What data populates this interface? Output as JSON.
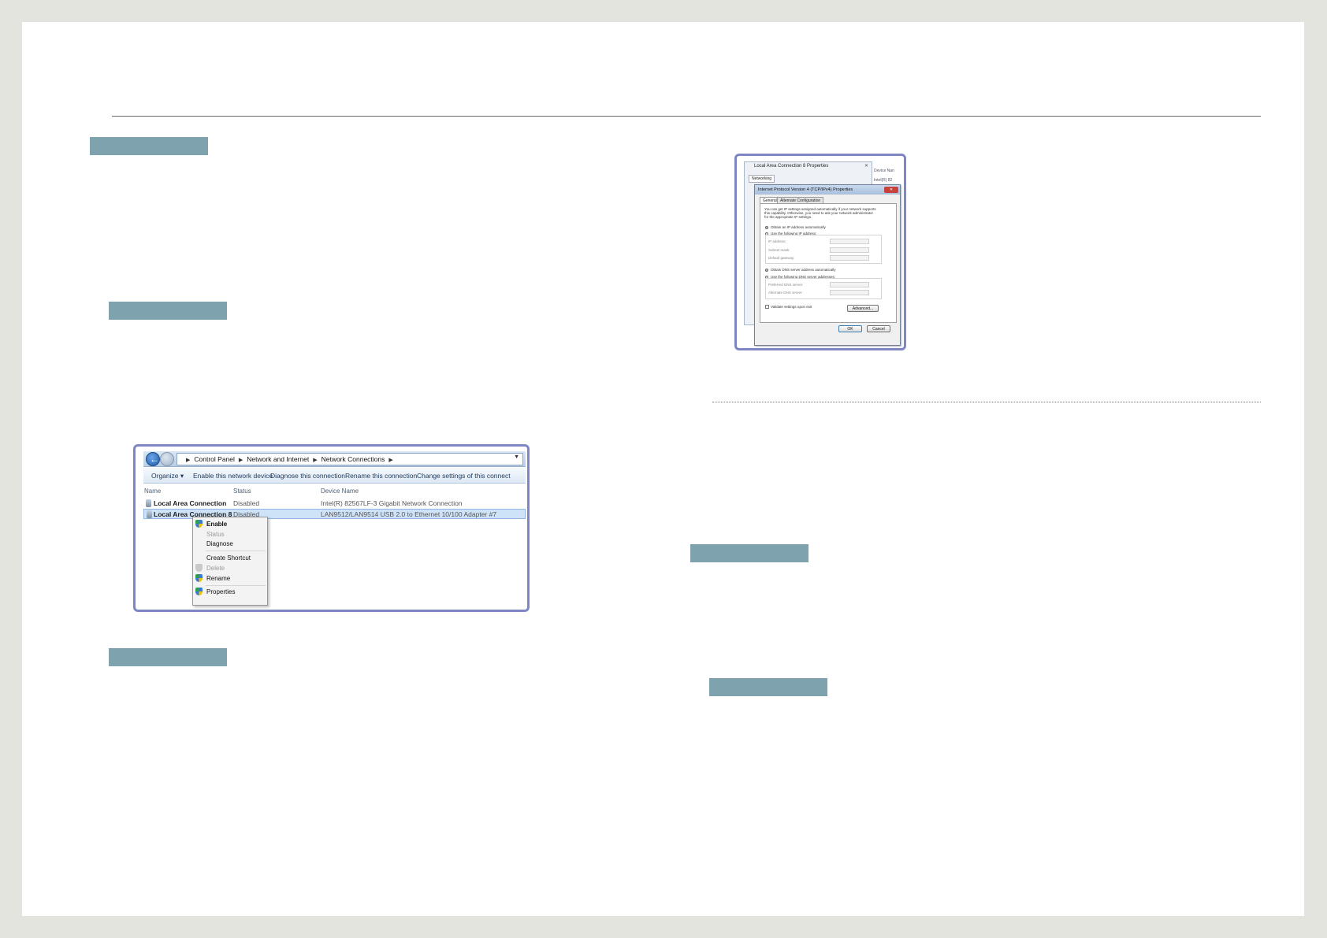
{
  "explorer": {
    "breadcrumb": [
      "Control Panel",
      "Network and Internet",
      "Network Connections"
    ],
    "toolbar": [
      "Organize ▾",
      "Enable this network device",
      "Diagnose this connection",
      "Rename this connection",
      "Change settings of this connect"
    ],
    "columns": [
      "Name",
      "Status",
      "Device Name"
    ],
    "rows": [
      {
        "name": "Local Area Connection",
        "status": "Disabled",
        "device": "Intel(R) 82567LF-3 Gigabit Network Connection"
      },
      {
        "name": "Local Area Connection 8",
        "status": "Disabled",
        "device": "LAN9512/LAN9514 USB 2.0 to Ethernet 10/100 Adapter #7"
      }
    ],
    "context_menu": [
      "Enable",
      "Status",
      "Diagnose",
      "Create Shortcut",
      "Delete",
      "Rename",
      "Properties"
    ]
  },
  "dialog": {
    "back_title": "Local Area Connection 8 Properties",
    "back_close": "✕",
    "back_tab": "Networking",
    "side_texts": [
      "Device Nan",
      "Intel(R) 82"
    ],
    "title": "Internet Protocol Version 4 (TCP/IPv4) Properties",
    "close": "✕",
    "tabs": [
      "General",
      "Alternate Configuration"
    ],
    "intro": [
      "You can get IP settings assigned automatically if your network supports",
      "this capability. Otherwise, you need to ask your network administrator",
      "for the appropriate IP settings."
    ],
    "obtain_ip": "Obtain an IP address automatically",
    "use_ip": "Use the following IP address:",
    "ip_fields": [
      "IP address:",
      "Subnet mask:",
      "Default gateway:"
    ],
    "obtain_dns": "Obtain DNS server address automatically",
    "use_dns": "Use the following DNS server addresses:",
    "dns_fields": [
      "Preferred DNS server:",
      "Alternate DNS server:"
    ],
    "validate": "Validate settings upon exit",
    "advanced": "Advanced...",
    "ok": "OK",
    "cancel": "Cancel"
  },
  "colors": {
    "label_bar": "#7fa3ae",
    "frame": "#7e86c4",
    "page": "#ffffff",
    "background": "#e4e4de"
  }
}
